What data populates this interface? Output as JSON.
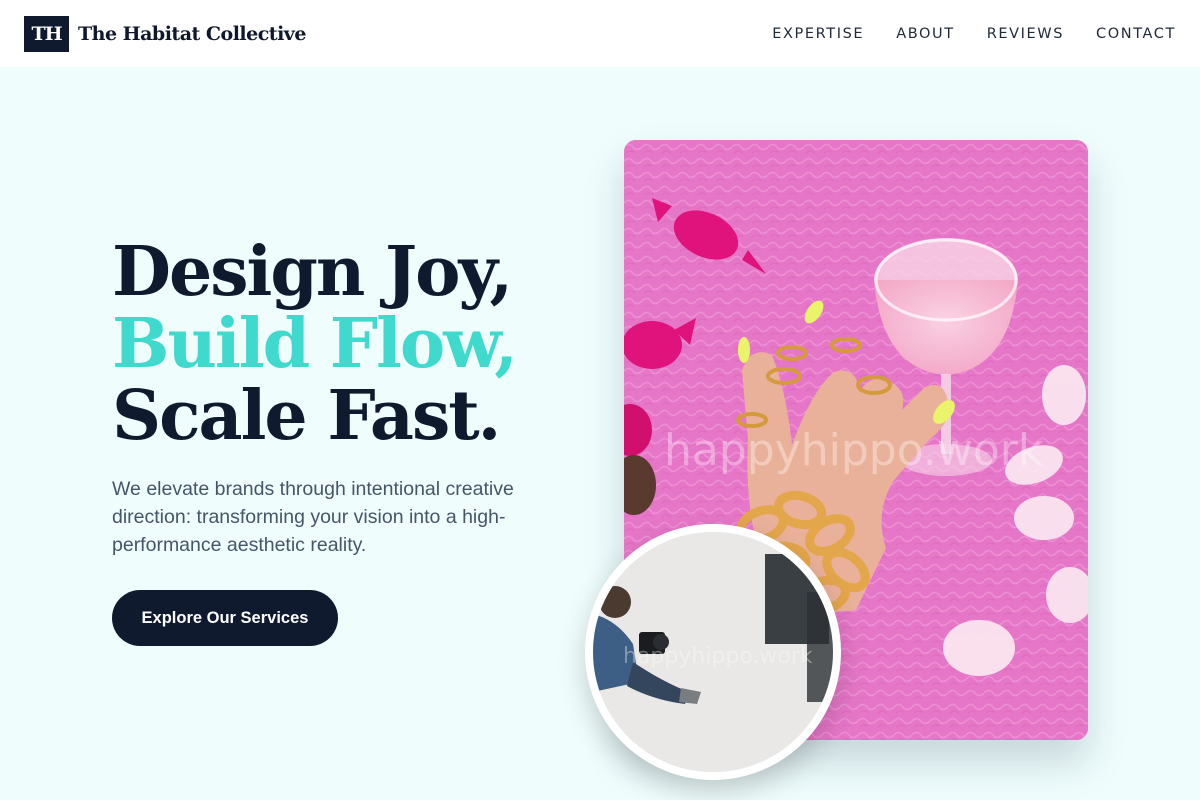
{
  "header": {
    "logo_initials": "TH",
    "brand_name": "The Habitat Collective",
    "nav": [
      "EXPERTISE",
      "ABOUT",
      "REVIEWS",
      "CONTACT"
    ]
  },
  "hero": {
    "title_line1": "Design Joy,",
    "title_line2": "Build Flow,",
    "title_line3": "Scale Fast.",
    "description": "We elevate brands through intentional creative direction: transforming your vision into a high-performance aesthetic reality.",
    "cta_label": "Explore Our Services"
  },
  "images": {
    "main_watermark": "happyhippo.work",
    "inset_watermark": "happyhippo.work"
  },
  "colors": {
    "navy": "#0f1a2e",
    "accent": "#40d9cd",
    "background": "#effdfd",
    "photo_pink": "#e677c8"
  },
  "icons": [
    "logo-mark-icon"
  ]
}
